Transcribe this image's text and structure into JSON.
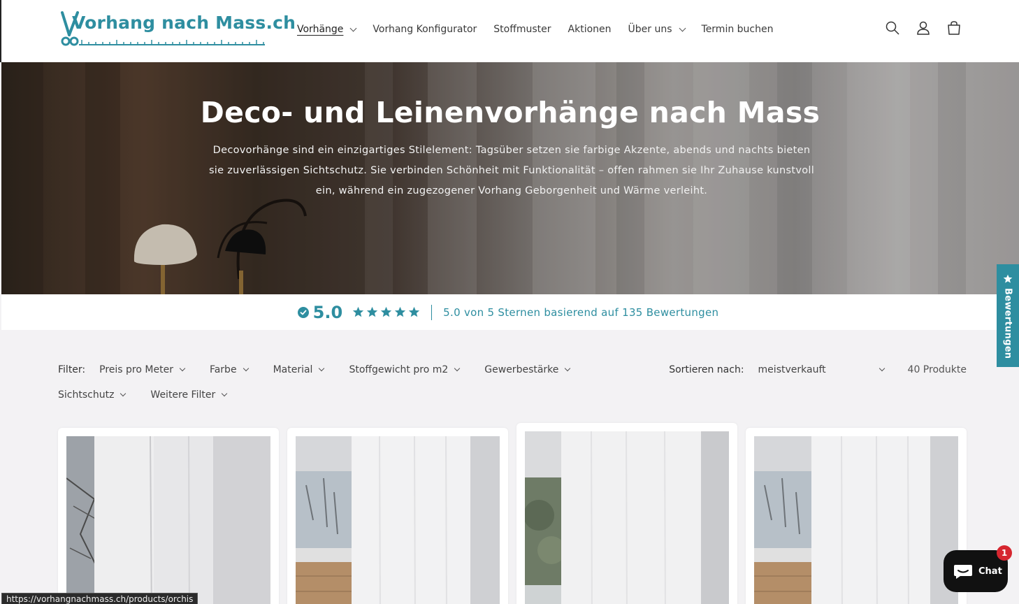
{
  "colors": {
    "brand": "#2e8ea0",
    "chat": "#111111",
    "badge": "#d6262f"
  },
  "header": {
    "logo_text": "Vorhang nach Mass.ch",
    "nav": [
      {
        "label": "Vorhänge",
        "has_dropdown": true,
        "active": true
      },
      {
        "label": "Vorhang Konfigurator",
        "has_dropdown": false
      },
      {
        "label": "Stoffmuster",
        "has_dropdown": false
      },
      {
        "label": "Aktionen",
        "has_dropdown": false
      },
      {
        "label": "Über uns",
        "has_dropdown": true
      },
      {
        "label": "Termin buchen",
        "has_dropdown": false
      }
    ],
    "icons": [
      "search-icon",
      "account-icon",
      "cart-icon"
    ]
  },
  "hero": {
    "title": "Deco- und Leinenvorhänge nach Mass",
    "text": "Decovorhänge sind ein einzigartiges Stilelement: Tagsüber setzen sie farbige Akzente, abends und nachts bieten sie zuverlässigen Sichtschutz. Sie verbinden Schönheit mit Funktionalität – offen rahmen sie Ihr Zuhause kunstvoll ein, während ein zugezogener Vorhang Geborgenheit und Wärme verleiht."
  },
  "rating": {
    "score": "5.0",
    "stars": 5,
    "text": "5.0 von 5 Sternen basierend auf 135 Bewertungen"
  },
  "filters": {
    "label": "Filter:",
    "items": [
      "Preis pro Meter",
      "Farbe",
      "Material",
      "Stoffgewicht pro m2",
      "Gewerbestärke",
      "Sichtschutz",
      "Weitere Filter"
    ],
    "sort_label": "Sortieren nach:",
    "sort_value": "meistverkauft",
    "count": "40 Produkte"
  },
  "side_tab": {
    "label": "Bewertungen"
  },
  "chat": {
    "label": "Chat",
    "badge": "1"
  },
  "status_url": "https://vorhangnachmass.ch/products/orchis"
}
